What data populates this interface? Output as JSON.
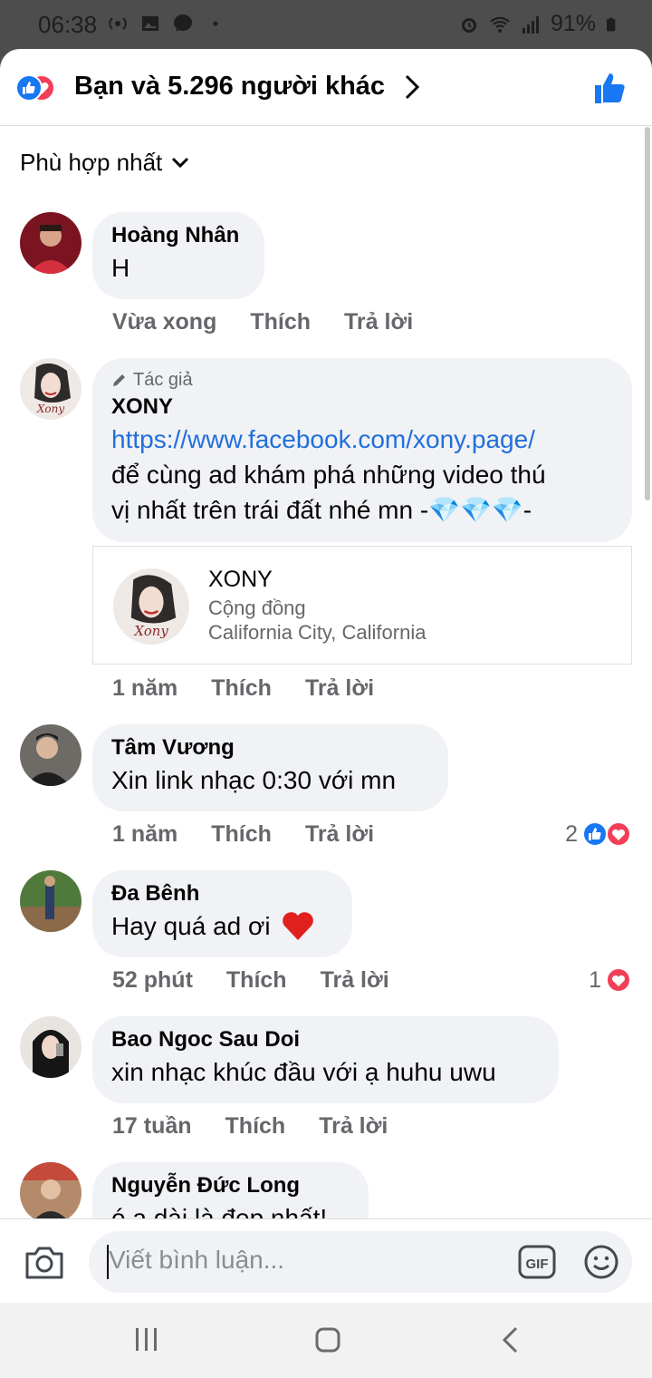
{
  "status_bar": {
    "time": "06:38",
    "battery": "91%"
  },
  "header": {
    "title": "Bạn và 5.296 người khác"
  },
  "sort": {
    "label": "Phù hợp nhất"
  },
  "comments": [
    {
      "name": "Hoàng Nhân",
      "text": "H",
      "time": "Vừa xong",
      "like": "Thích",
      "reply": "Trả lời"
    },
    {
      "author_tag": "Tác giả",
      "name": "XONY",
      "link": "https://www.facebook.com/xony.page/",
      "text_line1": "để cùng ad khám phá những video thú",
      "text_line2": "vị nhất trên trái đất nhé mn -💎💎💎-",
      "time": "1 năm",
      "like": "Thích",
      "reply": "Trả lời",
      "preview": {
        "title": "XONY",
        "category": "Cộng đồng",
        "location": "California City, California"
      }
    },
    {
      "name": "Tâm Vương",
      "text": "Xin link nhạc 0:30 với mn",
      "time": "1 năm",
      "like": "Thích",
      "reply": "Trả lời",
      "reactions": "2"
    },
    {
      "name": "Đa Bênh",
      "text": "Hay quá ad ơi",
      "time": "52 phút",
      "like": "Thích",
      "reply": "Trả lời",
      "reactions": "1"
    },
    {
      "name": "Bao Ngoc Sau Doi",
      "text": "xin nhạc khúc đầu với ạ huhu uwu",
      "time": "17 tuần",
      "like": "Thích",
      "reply": "Trả lời"
    },
    {
      "name": "Nguyễn Đức Long",
      "text": "ó ạ dài là đẹp nhất!"
    }
  ],
  "composer": {
    "placeholder": "Viết bình luận...",
    "gif_label": "GIF"
  },
  "colors": {
    "link": "#216fdb",
    "like_blue": "#1877f2",
    "love_red": "#f33e58",
    "bubble": "#f0f2f5"
  }
}
